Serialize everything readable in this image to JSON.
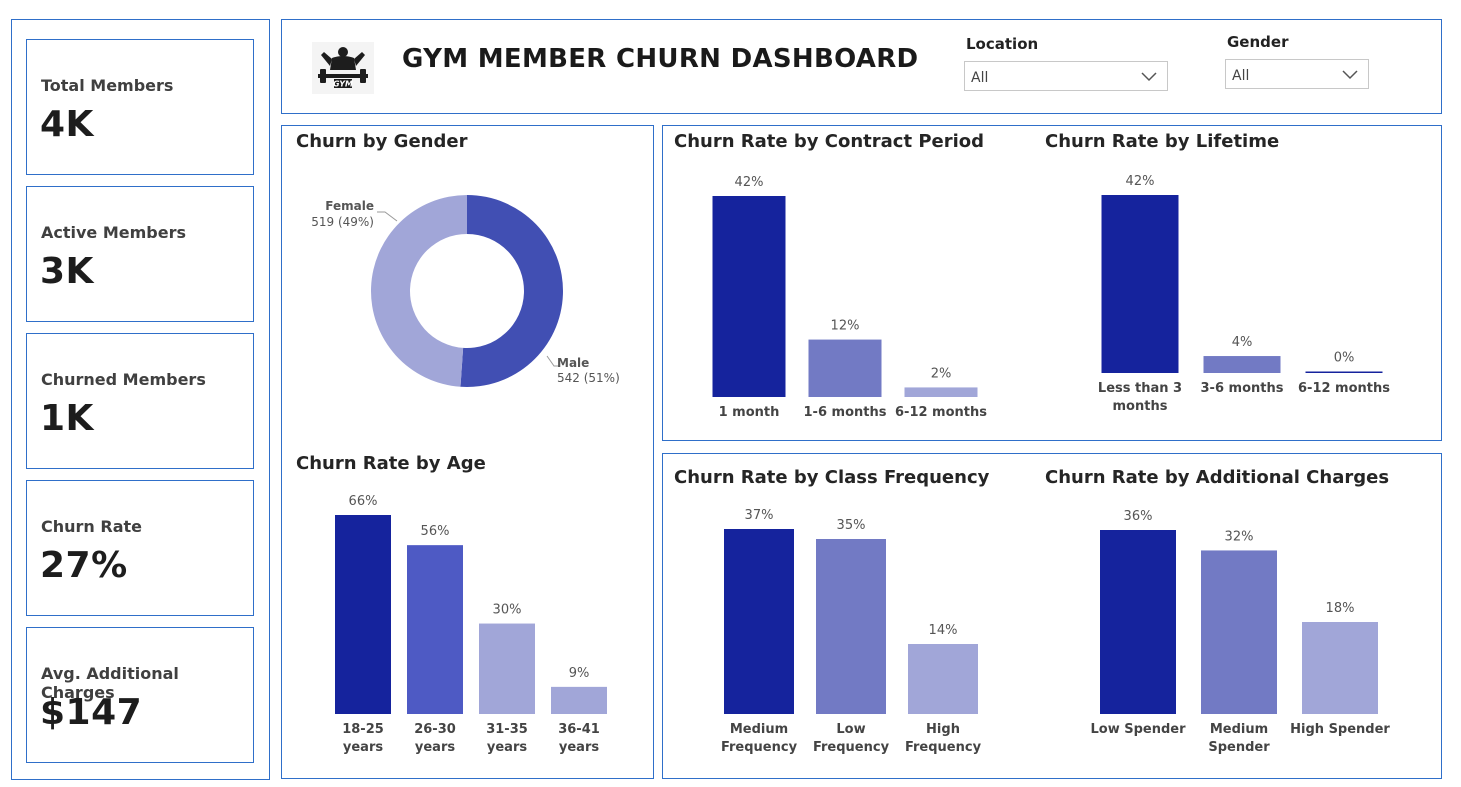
{
  "header": {
    "title": "GYM MEMBER CHURN DASHBOARD",
    "logo_text": "GYM",
    "filters": [
      {
        "label": "Location",
        "value": "All"
      },
      {
        "label": "Gender",
        "value": "All"
      }
    ]
  },
  "kpis": [
    {
      "label": "Total Members",
      "value": "4K"
    },
    {
      "label": "Active Members",
      "value": "3K"
    },
    {
      "label": "Churned Members",
      "value": "1K"
    },
    {
      "label": "Churn Rate",
      "value": "27%"
    },
    {
      "label": "Avg. Additional Charges",
      "value": "$147"
    }
  ],
  "colors": {
    "dark": "#15239d",
    "mid": "#4e5ac4",
    "medium_light": "#727ac4",
    "light": "#a1a6d8",
    "border": "#2f6fc9"
  },
  "chart_data": [
    {
      "type": "pie",
      "title": "Churn by Gender",
      "slices": [
        {
          "label": "Male",
          "value": 542,
          "text": "542 (51%)",
          "color": "#414fb3"
        },
        {
          "label": "Female",
          "value": 519,
          "text": "519 (49%)",
          "color": "#a1a6d8"
        }
      ]
    },
    {
      "type": "bar",
      "title": "Churn Rate by Age",
      "categories": [
        [
          "18-25",
          "years"
        ],
        [
          "26-30",
          "years"
        ],
        [
          "31-35",
          "years"
        ],
        [
          "36-41",
          "years"
        ]
      ],
      "values": [
        66,
        56,
        30,
        9
      ],
      "labels": [
        "66%",
        "56%",
        "30%",
        "9%"
      ],
      "colors": [
        "#15239d",
        "#4e5ac4",
        "#a1a6d8",
        "#a1a6d8"
      ]
    },
    {
      "type": "bar",
      "title": "Churn Rate by Contract Period",
      "categories": [
        [
          "1 month"
        ],
        [
          "1-6 months"
        ],
        [
          "6-12 months"
        ]
      ],
      "values": [
        42,
        12,
        2
      ],
      "labels": [
        "42%",
        "12%",
        "2%"
      ],
      "colors": [
        "#15239d",
        "#727ac4",
        "#a1a6d8"
      ]
    },
    {
      "type": "bar",
      "title": "Churn Rate by Lifetime",
      "categories": [
        [
          "Less than 3",
          "months"
        ],
        [
          "3-6 months"
        ],
        [
          "6-12 months"
        ]
      ],
      "values": [
        42,
        4,
        0
      ],
      "labels": [
        "42%",
        "4%",
        "0%"
      ],
      "colors": [
        "#15239d",
        "#727ac4",
        "#15239d"
      ]
    },
    {
      "type": "bar",
      "title": "Churn Rate by Class Frequency",
      "categories": [
        [
          "Medium",
          "Frequency"
        ],
        [
          "Low",
          "Frequency"
        ],
        [
          "High",
          "Frequency"
        ]
      ],
      "values": [
        37,
        35,
        14
      ],
      "labels": [
        "37%",
        "35%",
        "14%"
      ],
      "colors": [
        "#15239d",
        "#727ac4",
        "#a1a6d8"
      ]
    },
    {
      "type": "bar",
      "title": "Churn Rate by Additional Charges",
      "categories": [
        [
          "Low Spender"
        ],
        [
          "Medium",
          "Spender"
        ],
        [
          "High Spender"
        ]
      ],
      "values": [
        36,
        32,
        18
      ],
      "labels": [
        "36%",
        "32%",
        "18%"
      ],
      "colors": [
        "#15239d",
        "#727ac4",
        "#a1a6d8"
      ]
    }
  ]
}
